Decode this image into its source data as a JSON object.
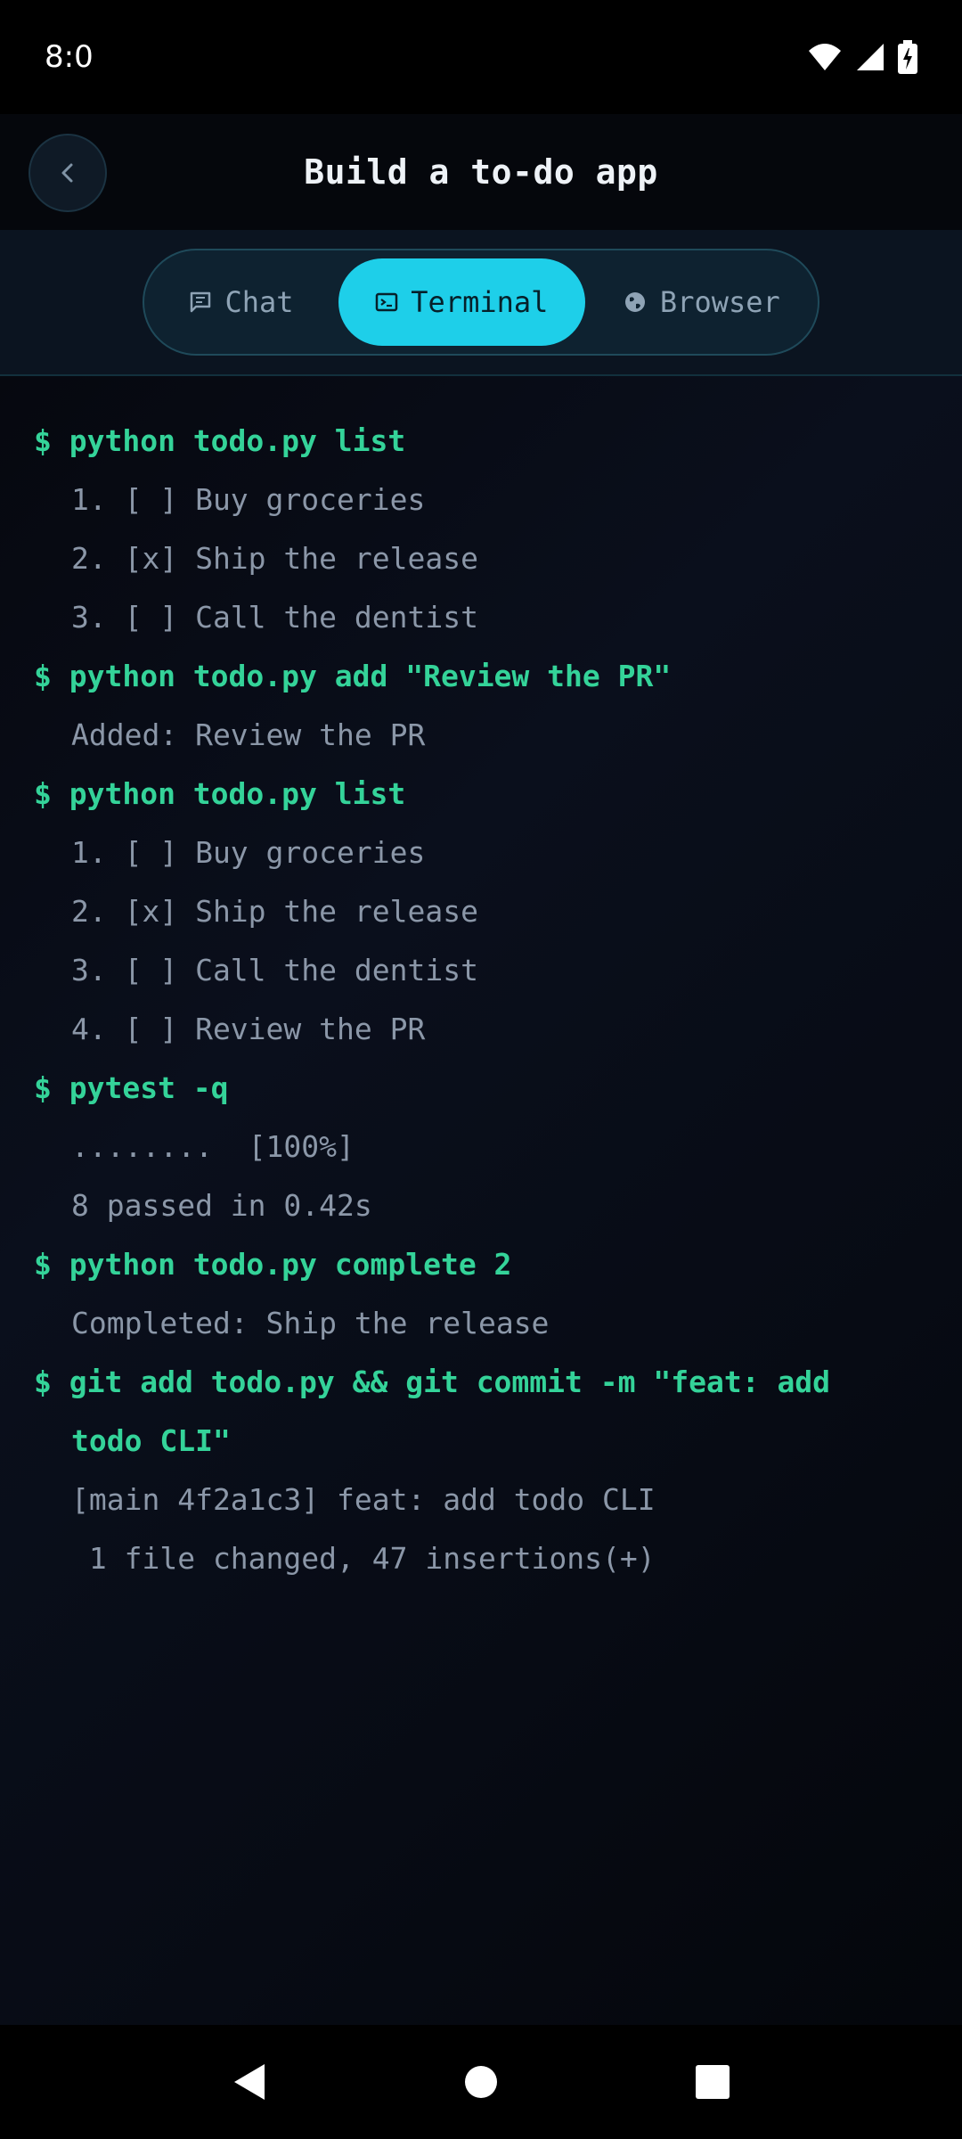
{
  "status_bar": {
    "time": "8:0"
  },
  "header": {
    "title": "Build a to-do app"
  },
  "tabs": [
    {
      "label": "Chat",
      "icon": "chat-icon",
      "active": false
    },
    {
      "label": "Terminal",
      "icon": "terminal-icon",
      "active": true
    },
    {
      "label": "Browser",
      "icon": "globe-icon",
      "active": false
    }
  ],
  "colors": {
    "accent": "#1ecfe9",
    "command": "#34d399",
    "output": "#8b97a8"
  },
  "terminal": {
    "lines": [
      {
        "type": "cmd",
        "text": "$ python todo.py list"
      },
      {
        "type": "out",
        "text": "1. [ ] Buy groceries"
      },
      {
        "type": "out",
        "text": "2. [x] Ship the release"
      },
      {
        "type": "out",
        "text": "3. [ ] Call the dentist"
      },
      {
        "type": "cmd",
        "text": "$ python todo.py add \"Review the PR\""
      },
      {
        "type": "out",
        "text": "Added: Review the PR"
      },
      {
        "type": "cmd",
        "text": "$ python todo.py list"
      },
      {
        "type": "out",
        "text": "1. [ ] Buy groceries"
      },
      {
        "type": "out",
        "text": "2. [x] Ship the release"
      },
      {
        "type": "out",
        "text": "3. [ ] Call the dentist"
      },
      {
        "type": "out",
        "text": "4. [ ] Review the PR"
      },
      {
        "type": "cmd",
        "text": "$ pytest -q"
      },
      {
        "type": "out",
        "text": "........  [100%]"
      },
      {
        "type": "out",
        "text": "8 passed in 0.42s"
      },
      {
        "type": "cmd",
        "text": "$ python todo.py complete 2"
      },
      {
        "type": "out",
        "text": "Completed: Ship the release"
      },
      {
        "type": "cmd",
        "text": "$ git add todo.py && git commit -m \"feat: add"
      },
      {
        "type": "cmd-wrap",
        "text": "todo CLI\""
      },
      {
        "type": "out",
        "text": "[main 4f2a1c3] feat: add todo CLI"
      },
      {
        "type": "out",
        "text": " 1 file changed, 47 insertions(+)"
      }
    ]
  }
}
